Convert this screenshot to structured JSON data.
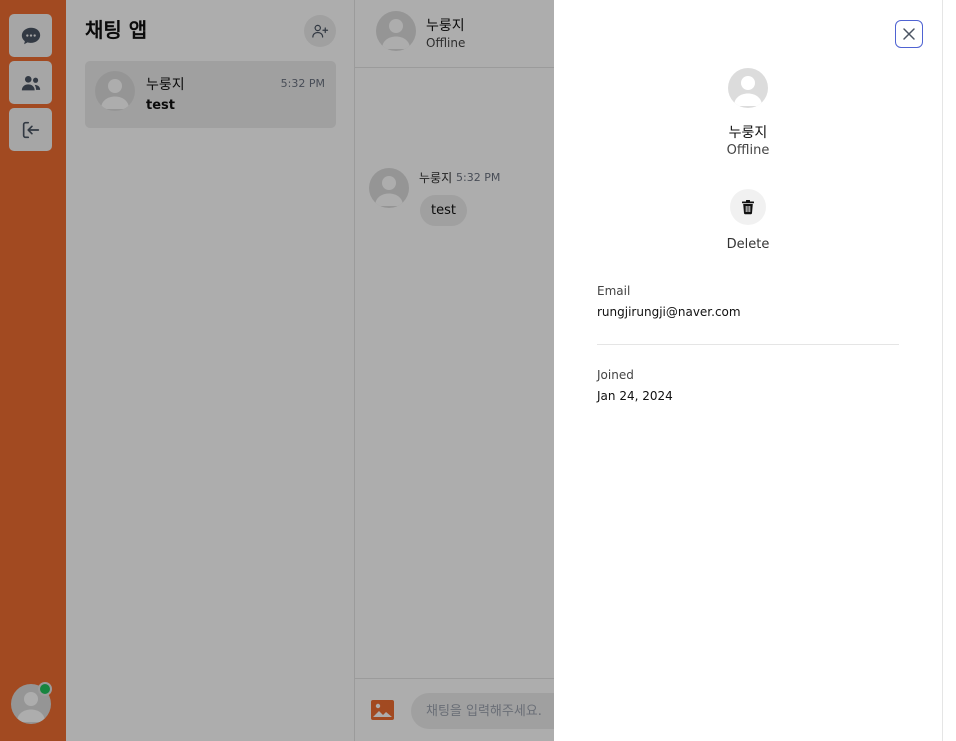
{
  "sidebar": {
    "items": [
      {
        "icon": "chat-bubble-icon",
        "label": ""
      },
      {
        "icon": "users-icon",
        "label": ""
      },
      {
        "icon": "logout-icon",
        "label": ""
      }
    ],
    "accent_color": "#ef6d31"
  },
  "conversation_list": {
    "title": "채팅 앱",
    "add_friend_icon": "user-plus-icon",
    "conversations": [
      {
        "name": "누룽지",
        "time": "5:32 PM",
        "last_message": "test"
      }
    ]
  },
  "chat": {
    "header": {
      "name": "누룽지",
      "status": "Offline"
    },
    "messages": [
      {
        "sender": "누룽지",
        "time": "5:32 PM",
        "text": "test"
      }
    ],
    "composer": {
      "placeholder": "채팅을 입력해주세요.",
      "image_icon": "image-icon"
    }
  },
  "profile": {
    "close_icon": "close-icon",
    "name": "누룽지",
    "status": "Offline",
    "delete_label": "Delete",
    "fields": [
      {
        "label": "Email",
        "value": "rungjirungji@naver.com"
      },
      {
        "label": "Joined",
        "value": "Jan 24, 2024"
      }
    ]
  }
}
